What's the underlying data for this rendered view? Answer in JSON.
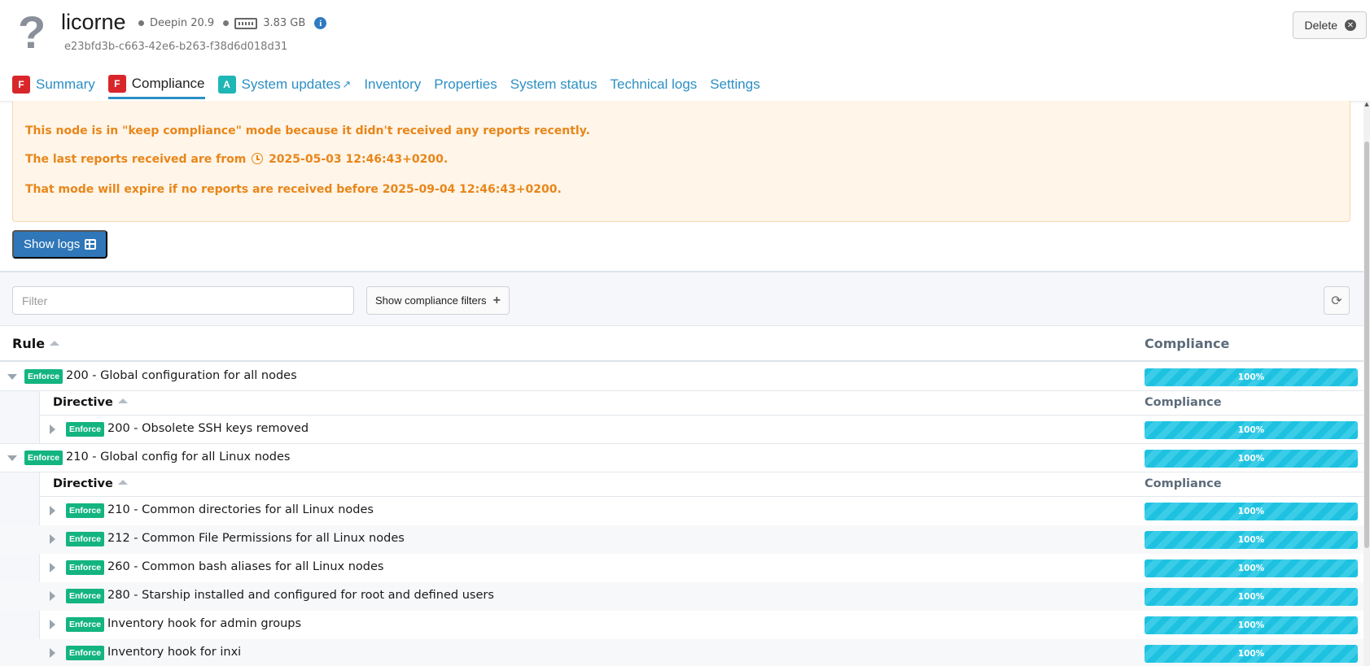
{
  "node": {
    "name": "licorne",
    "os": "Deepin 20.9",
    "ram": "3.83 GB",
    "uuid": "e23bfd3b-c663-42e6-b263-f38d6d018d31",
    "delete_label": "Delete"
  },
  "tabs": [
    {
      "badge": "F",
      "badge_color": "#d9262b",
      "label": "Summary"
    },
    {
      "badge": "F",
      "badge_color": "#d9262b",
      "label": "Compliance",
      "active": true
    },
    {
      "badge": "A",
      "badge_color": "#1fb6b6",
      "label": "System updates"
    },
    {
      "label": "Inventory"
    },
    {
      "label": "Properties"
    },
    {
      "label": "System status"
    },
    {
      "label": "Technical logs"
    },
    {
      "label": "Settings"
    }
  ],
  "warning": {
    "line1": "This node is in \"keep compliance\" mode because it didn't received any reports recently.",
    "line2_prefix": "The last reports received are from",
    "line2_date": "2025-05-03 12:46:43+0200",
    "line2_suffix": ".",
    "line3": "That mode will expire if no reports are received before 2025-09-04 12:46:43+0200."
  },
  "show_logs_label": "Show logs",
  "filter": {
    "placeholder": "Filter",
    "compliance_filters_label": "Show compliance filters"
  },
  "table": {
    "rule_header": "Rule",
    "compliance_header": "Compliance",
    "directive_header": "Directive",
    "enforce_label": "Enforce",
    "rules": [
      {
        "name": "200 - Global configuration for all nodes",
        "compliance": "100%",
        "directives": [
          {
            "name": "200 - Obsolete SSH keys removed",
            "compliance": "100%"
          }
        ]
      },
      {
        "name": "210 - Global config for all Linux nodes",
        "compliance": "100%",
        "directives": [
          {
            "name": "210 - Common directories for all Linux nodes",
            "compliance": "100%"
          },
          {
            "name": "212 - Common File Permissions for all Linux nodes",
            "compliance": "100%"
          },
          {
            "name": "260 - Common bash aliases for all Linux nodes",
            "compliance": "100%"
          },
          {
            "name": "280 - Starship installed and configured for root and defined users",
            "compliance": "100%"
          },
          {
            "name": "Inventory hook for admin groups",
            "compliance": "100%"
          },
          {
            "name": "Inventory hook for inxi",
            "compliance": "100%"
          }
        ]
      }
    ]
  }
}
